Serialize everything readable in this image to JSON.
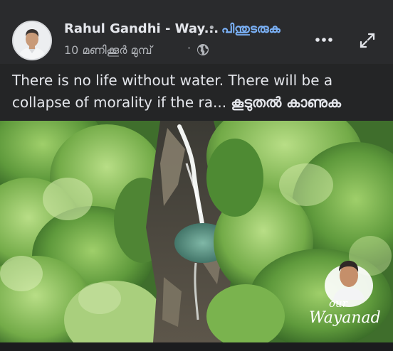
{
  "post": {
    "author_name": "Rahul Gandhi - Way...",
    "separator": "•",
    "follow_label": "പിന്തുടരുക",
    "timestamp": "10 മണിക്കൂർ മുമ്പ്",
    "meta_separator": "·",
    "caption_text": "There is no life without water. There will be a collapse of morality if the ra...",
    "see_more_label": "കൂടുതൽ കാണുക"
  },
  "icons": {
    "privacy": "globe-icon",
    "menu": "more-options-icon",
    "expand": "expand-icon"
  },
  "photo_overlay": {
    "logo_text_line1": "our",
    "logo_text_line2": "Wayanad"
  },
  "colors": {
    "background": "#242526",
    "follow_link": "#7ab0f5",
    "text_primary": "#e4e6eb",
    "text_secondary": "#b0b3b8"
  }
}
